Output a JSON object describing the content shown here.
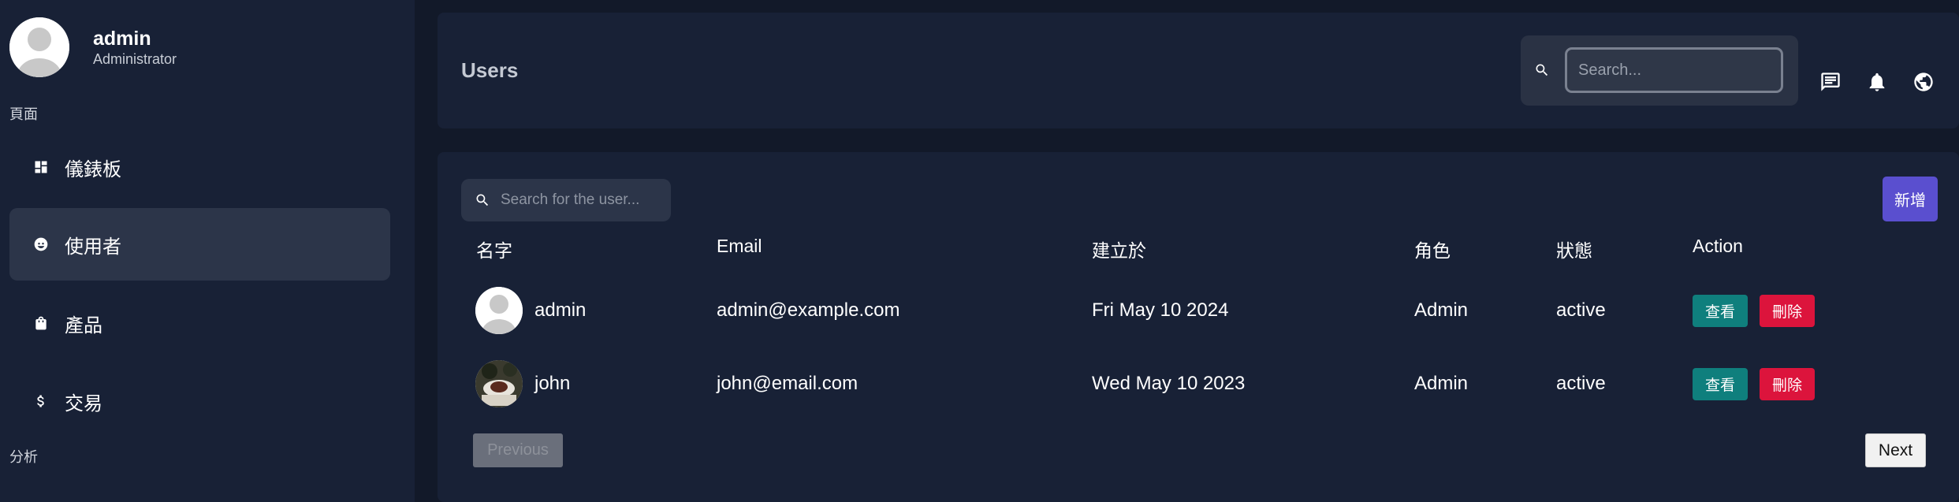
{
  "sidebar": {
    "profile": {
      "name": "admin",
      "role": "Administrator"
    },
    "sections": [
      {
        "label": "頁面"
      },
      {
        "label": "分析"
      }
    ],
    "items": [
      {
        "label": "儀錶板",
        "icon": "dashboard-icon"
      },
      {
        "label": "使用者",
        "icon": "face-icon",
        "active": true
      },
      {
        "label": "產品",
        "icon": "shopping-bag-icon"
      },
      {
        "label": "交易",
        "icon": "dollar-icon"
      }
    ]
  },
  "header": {
    "title": "Users",
    "search_placeholder": "Search...",
    "icons": [
      "chat-icon",
      "notification-bell-icon",
      "globe-icon"
    ]
  },
  "main": {
    "search_placeholder": "Search for the user...",
    "add_label": "新增",
    "columns": [
      "名字",
      "Email",
      "建立於",
      "角色",
      "狀態",
      "Action"
    ],
    "rows": [
      {
        "name": "admin",
        "email": "admin@example.com",
        "created": "Fri May 10 2024",
        "role": "Admin",
        "status": "active",
        "view_label": "查看",
        "delete_label": "刪除"
      },
      {
        "name": "john",
        "email": "john@email.com",
        "created": "Wed May 10 2023",
        "role": "Admin",
        "status": "active",
        "view_label": "查看",
        "delete_label": "刪除"
      }
    ],
    "prev_label": "Previous",
    "next_label": "Next"
  },
  "colors": {
    "background": "#121929",
    "panel": "#182136",
    "active_nav": "#2c3549",
    "add_button": "#5a4fcf",
    "view_button": "#0f7f7d",
    "delete_button": "#dc143c"
  }
}
